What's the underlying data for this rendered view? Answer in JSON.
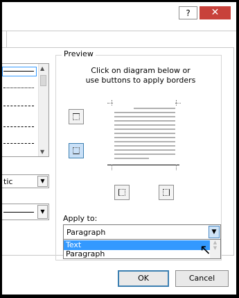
{
  "titlebar": {
    "help_label": "?",
    "close_label": "✕"
  },
  "left": {
    "style_combo_value": "tic"
  },
  "preview": {
    "group_title": "Preview",
    "hint_line1": "Click on diagram below or",
    "hint_line2": "use buttons to apply borders"
  },
  "apply_to": {
    "label": "Apply to:",
    "value": "Paragraph",
    "options": [
      "Text",
      "Paragraph"
    ],
    "selected_index": 0
  },
  "buttons": {
    "ok": "OK",
    "cancel": "Cancel"
  }
}
